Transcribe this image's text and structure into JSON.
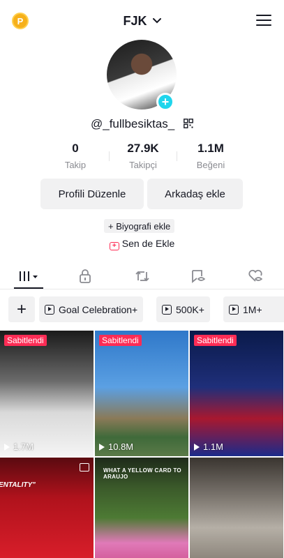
{
  "header": {
    "coin_label": "P",
    "title": "FJK"
  },
  "profile": {
    "username": "@_fullbesiktas_",
    "stats": [
      {
        "value": "0",
        "label": "Takip"
      },
      {
        "value": "27.9K",
        "label": "Takipçi"
      },
      {
        "value": "1.1M",
        "label": "Beğeni"
      }
    ],
    "edit_button": "Profili Düzenle",
    "add_friend_button": "Arkadaş ekle",
    "bio_chip": "+ Biyografi ekle",
    "add_yours": "Sen de Ekle"
  },
  "tabs": [
    "videos",
    "private",
    "reposts",
    "favorites",
    "liked"
  ],
  "playlists": {
    "add_label": "+",
    "items": [
      "Goal Celebration+",
      "500K+",
      "1M+"
    ]
  },
  "grid": {
    "pinned_label": "Sabitlendi",
    "videos": [
      {
        "views": "1.7M",
        "pinned": true
      },
      {
        "views": "10.8M",
        "pinned": true
      },
      {
        "views": "1.1M",
        "pinned": true
      },
      {
        "views": "",
        "pinned": false,
        "caption": "ENTALITY\""
      },
      {
        "views": "",
        "pinned": false,
        "caption": "WHAT A YELLOW CARD TO ARAUJO"
      },
      {
        "views": "",
        "pinned": false
      }
    ]
  },
  "colors": {
    "accent_cyan": "#20d5ec",
    "pin_red": "#fe2c55",
    "coin_gold": "#f6b01a"
  }
}
